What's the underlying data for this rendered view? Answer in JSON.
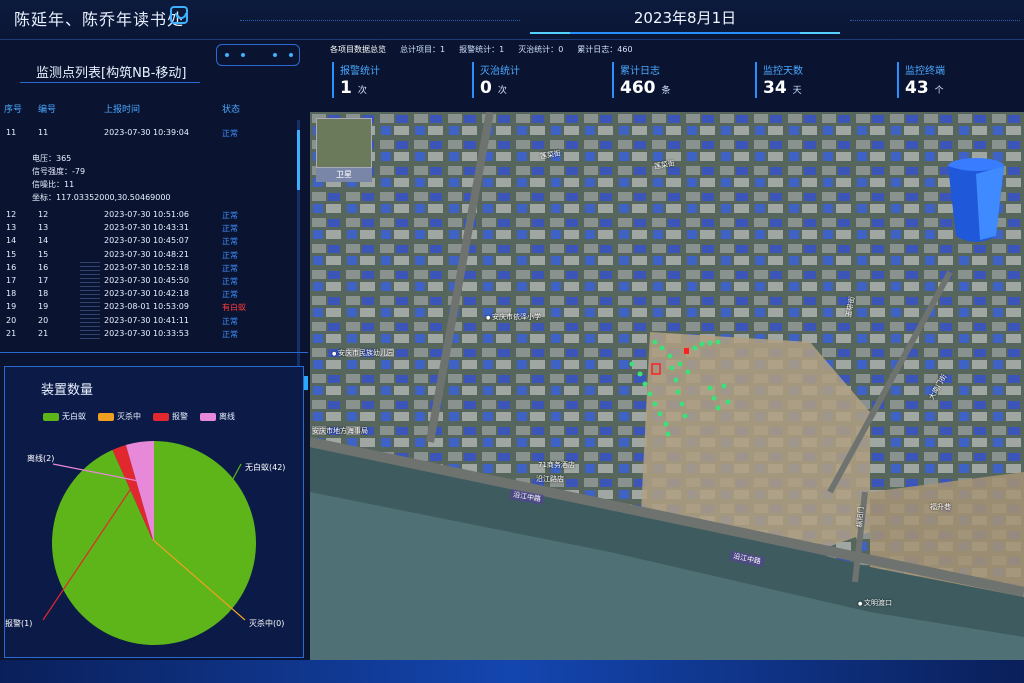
{
  "header": {
    "title": "陈延年、陈乔年读书处",
    "date": "2023年8月1日"
  },
  "stats": {
    "summary_label": "各项目数据总览",
    "summary": [
      {
        "label": "总计项目：",
        "value": "1"
      },
      {
        "label": "报警统计：",
        "value": "1"
      },
      {
        "label": "灭治统计：",
        "value": "0"
      },
      {
        "label": "累计日志：",
        "value": "460"
      }
    ],
    "cards": [
      {
        "label": "报警统计",
        "value": "1",
        "unit": "次"
      },
      {
        "label": "灭治统计",
        "value": "0",
        "unit": "次"
      },
      {
        "label": "累计日志",
        "value": "460",
        "unit": "条"
      },
      {
        "label": "监控天数",
        "value": "34",
        "unit": "天"
      },
      {
        "label": "监控终端",
        "value": "43",
        "unit": "个"
      }
    ]
  },
  "list": {
    "title": "监测点列表[构筑NB-移动]",
    "columns": [
      "序号",
      "编号",
      "上报时间",
      "状态"
    ],
    "expanded_row": {
      "index": "11",
      "code": "11",
      "time": "2023-07-30 10:39:04",
      "status": "正常"
    },
    "details": {
      "voltage": "电压：365",
      "signal": "信号强度：-79",
      "snr": "信噪比：11",
      "coords": "坐标：117.03352000,30.50469000"
    },
    "rows": [
      {
        "index": "12",
        "code": "12",
        "time": "2023-07-30 10:51:06",
        "status": "正常",
        "alarm": false
      },
      {
        "index": "13",
        "code": "13",
        "time": "2023-07-30 10:43:31",
        "status": "正常",
        "alarm": false
      },
      {
        "index": "14",
        "code": "14",
        "time": "2023-07-30 10:45:07",
        "status": "正常",
        "alarm": false
      },
      {
        "index": "15",
        "code": "15",
        "time": "2023-07-30 10:48:21",
        "status": "正常",
        "alarm": false
      },
      {
        "index": "16",
        "code": "16",
        "time": "2023-07-30 10:52:18",
        "status": "正常",
        "alarm": false
      },
      {
        "index": "17",
        "code": "17",
        "time": "2023-07-30 10:45:50",
        "status": "正常",
        "alarm": false
      },
      {
        "index": "18",
        "code": "18",
        "time": "2023-07-30 10:42:18",
        "status": "正常",
        "alarm": false
      },
      {
        "index": "19",
        "code": "19",
        "time": "2023-08-01 10:53:09",
        "status": "有白蚁",
        "alarm": true
      },
      {
        "index": "20",
        "code": "20",
        "time": "2023-07-30 10:41:11",
        "status": "正常",
        "alarm": false
      },
      {
        "index": "21",
        "code": "21",
        "time": "2023-07-30 10:33:53",
        "status": "正常",
        "alarm": false
      }
    ]
  },
  "device_panel": {
    "title": "装置数量",
    "legend": [
      {
        "name": "无白蚁",
        "color": "#5db51a"
      },
      {
        "name": "灭杀中",
        "color": "#f0a020"
      },
      {
        "name": "报警",
        "color": "#e0282e"
      },
      {
        "name": "离线",
        "color": "#e888d8"
      }
    ]
  },
  "chart_data": {
    "type": "pie",
    "title": "装置数量",
    "categories": [
      "无白蚁",
      "灭杀中",
      "报警",
      "离线"
    ],
    "values": [
      42,
      0,
      1,
      2
    ],
    "labels": [
      "无白蚁(42)",
      "灭杀中(0)",
      "报警(1)",
      "离线(2)"
    ],
    "colors": [
      "#5db51a",
      "#f0a020",
      "#e0282e",
      "#e888d8"
    ],
    "legend_position": "top"
  },
  "map": {
    "satellite_button": "卫星",
    "labels": {
      "street_1": "莲菜街",
      "street_2": "莲菜街",
      "school": "安庆市依泽小学",
      "kindergarten": "安庆市民族幼儿园",
      "maritime": "安庆市地方海事局",
      "hotel1": "71商务酒店",
      "hotel2": "沿江路店",
      "river_road_1": "沿江中路",
      "river_road_2": "沿江中路",
      "dananmen": "大南门街",
      "street_3": "玉带街",
      "street_4": "枞阳门",
      "street_5": "福升巷",
      "ferry": "文明渡口"
    }
  }
}
